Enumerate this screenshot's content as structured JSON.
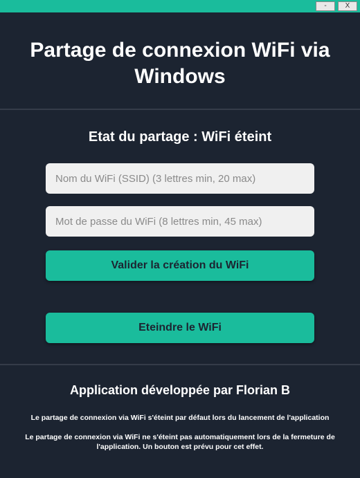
{
  "titlebar": {
    "minimize": "-",
    "close": "X"
  },
  "header": {
    "title": "Partage de connexion WiFi via Windows"
  },
  "status": {
    "label": "Etat du partage : WiFi éteint"
  },
  "form": {
    "ssid_value": "",
    "ssid_placeholder": "Nom du WiFi (SSID) (3 lettres min, 20 max)",
    "password_value": "",
    "password_placeholder": "Mot de passe du WiFi (8 lettres min, 45 max)",
    "validate_label": "Valider la création du WiFi",
    "turnoff_label": "Eteindre le WiFi"
  },
  "footer": {
    "credits": "Application développée par Florian B",
    "note1": "Le partage de connexion via WiFi s'éteint par défaut lors du lancement de l'application",
    "note2": "Le partage de connexion via WiFi ne s'éteint pas automatiquement lors de la fermeture de l'application. Un bouton est prévu pour cet effet."
  },
  "colors": {
    "accent": "#1abc9c",
    "background": "#1c2431"
  }
}
